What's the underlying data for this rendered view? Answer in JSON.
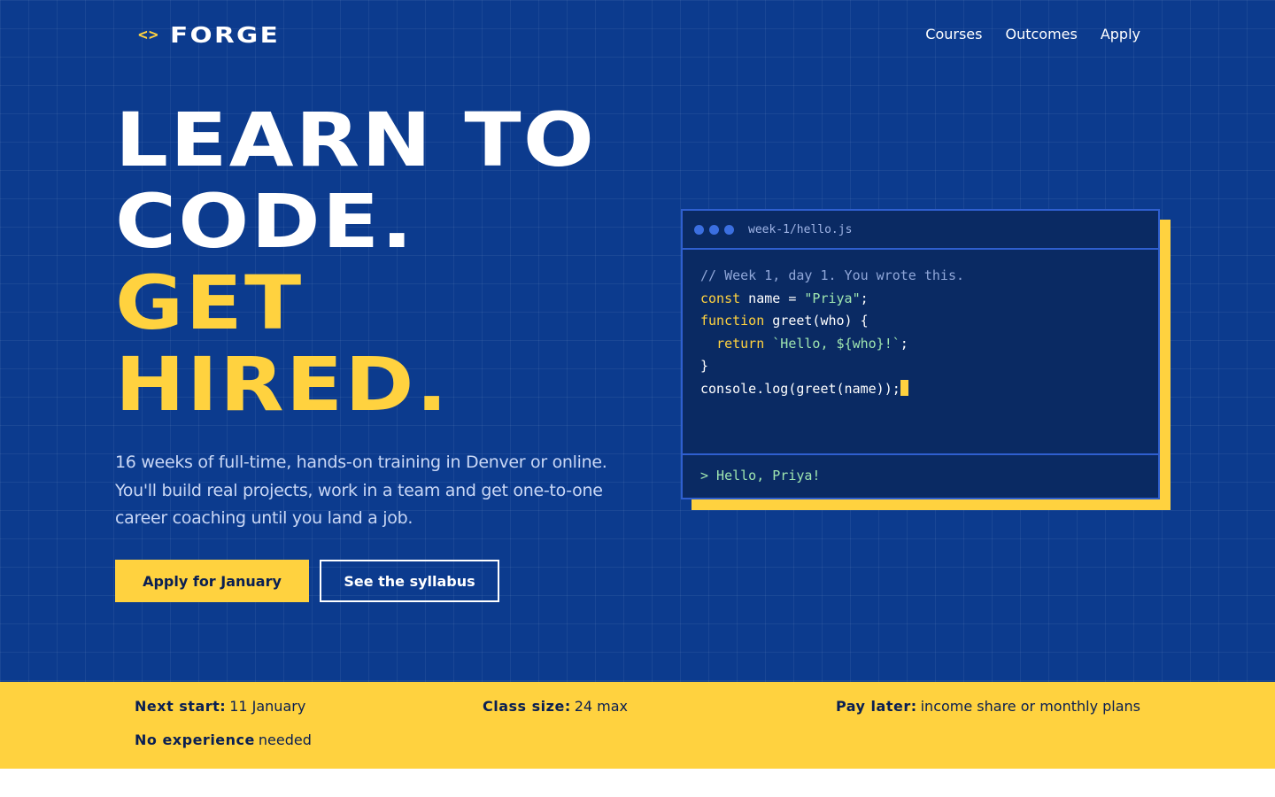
{
  "brand": {
    "logo_icon": "<>",
    "name": "FORGE"
  },
  "nav": {
    "items": [
      "Courses",
      "Outcomes",
      "Apply"
    ]
  },
  "hero": {
    "headline": [
      "LEARN TO",
      "CODE.",
      "GET",
      "HIRED."
    ],
    "subtext": "16 weeks of full-time, hands-on training in Denver or online. You'll build real projects, work in a team and get one-to-one career coaching until you land a job.",
    "primary_cta": "Apply for January",
    "secondary_cta": "See the syllabus"
  },
  "code_window": {
    "filename": "week-1/hello.js",
    "lines": [
      "// Week 1, day 1. You wrote this.",
      "const name = \"Priya\";",
      "function greet(who) {",
      "  return `Hello, ${who}!`;",
      "}",
      "console.log(greet(name));"
    ],
    "output": "> Hello, Priya!"
  },
  "facts": [
    {
      "label": "Next start:",
      "value": "11 January"
    },
    {
      "label": "Class size:",
      "value": "24 max"
    },
    {
      "label": "Pay later:",
      "value": "income share or monthly plans"
    },
    {
      "label": "No experience",
      "value": "needed"
    }
  ],
  "colors": {
    "hero_bg": "#0c3b8e",
    "accent": "#ffd23f",
    "code_bg": "#0a2a63",
    "ink": "#0a1f52"
  }
}
